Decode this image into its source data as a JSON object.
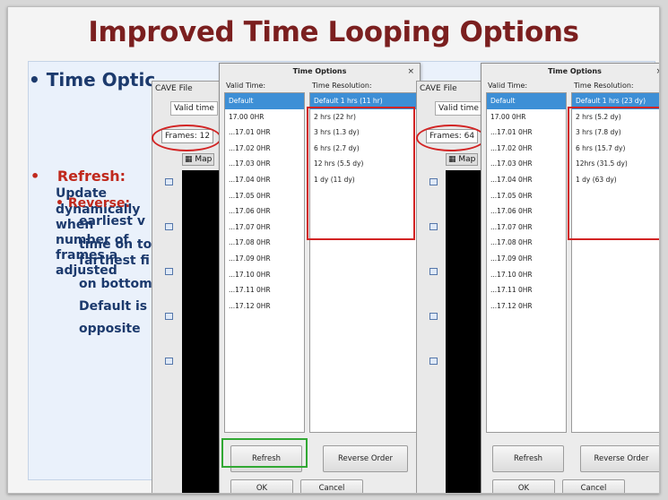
{
  "slide": {
    "title": "Improved Time Looping Options"
  },
  "left_text": {
    "bullet1": "• Time Optic",
    "bullet2": "•",
    "refresh_label": "Refresh:",
    "line_update": "Update",
    "line_dynamically": "dynamically",
    "line_when": "when",
    "line_number_of": "number of",
    "line_frames_a": "frames a",
    "line_adjusted": "adjusted",
    "reverse_label": "• Reverse:",
    "rev_earliest": "earliest v",
    "rev_time_on": "time on to",
    "rev_farthest": "farthest fi",
    "rev_on_bottom": "on bottom",
    "rev_default": "Default is",
    "rev_opposite": "opposite"
  },
  "app_left": {
    "menu": "CAVE  File",
    "valid_time": "Valid time",
    "frames": "Frames: 12",
    "map": "Map"
  },
  "app_right": {
    "menu": "CAVE  File",
    "valid_time": "Valid time",
    "frames": "Frames: 64",
    "map": "Map"
  },
  "dialog_left": {
    "title": "Time Options",
    "close": "×",
    "valid_time_header": "Valid Time:",
    "resolution_header": "Time Resolution:",
    "valid_times": [
      "Default",
      "17.00 0HR",
      "...17.01 0HR",
      "...17.02 0HR",
      "...17.03 0HR",
      "...17.04 0HR",
      "...17.05 0HR",
      "...17.06 0HR",
      "...17.07 0HR",
      "...17.08 0HR",
      "...17.09 0HR",
      "...17.10 0HR",
      "...17.11 0HR",
      "...17.12 0HR"
    ],
    "resolutions": [
      "Default 1 hrs (11 hr)",
      "2 hrs (22 hr)",
      "3 hrs (1.3 dy)",
      "6 hrs (2.7 dy)",
      "12 hrs (5.5 dy)",
      "1 dy (11 dy)"
    ],
    "refresh": "Refresh",
    "reverse_order": "Reverse Order",
    "ok": "OK",
    "cancel": "Cancel"
  },
  "dialog_right": {
    "title": "Time Options",
    "close": "×",
    "valid_time_header": "Valid Time:",
    "resolution_header": "Time Resolution:",
    "valid_times": [
      "Default",
      "17.00 0HR",
      "...17.01 0HR",
      "...17.02 0HR",
      "...17.03 0HR",
      "...17.04 0HR",
      "...17.05 0HR",
      "...17.06 0HR",
      "...17.07 0HR",
      "...17.08 0HR",
      "...17.09 0HR",
      "...17.10 0HR",
      "...17.11 0HR",
      "...17.12 0HR"
    ],
    "resolutions": [
      "Default 1 hrs (23 dy)",
      "2 hrs (5.2 dy)",
      "3 hrs (7.8 dy)",
      "6 hrs (15.7 dy)",
      "12hrs (31.5 dy)",
      "1 dy (63 dy)"
    ],
    "refresh": "Refresh",
    "reverse_order": "Reverse Order",
    "ok": "OK",
    "cancel": "Cancel"
  }
}
